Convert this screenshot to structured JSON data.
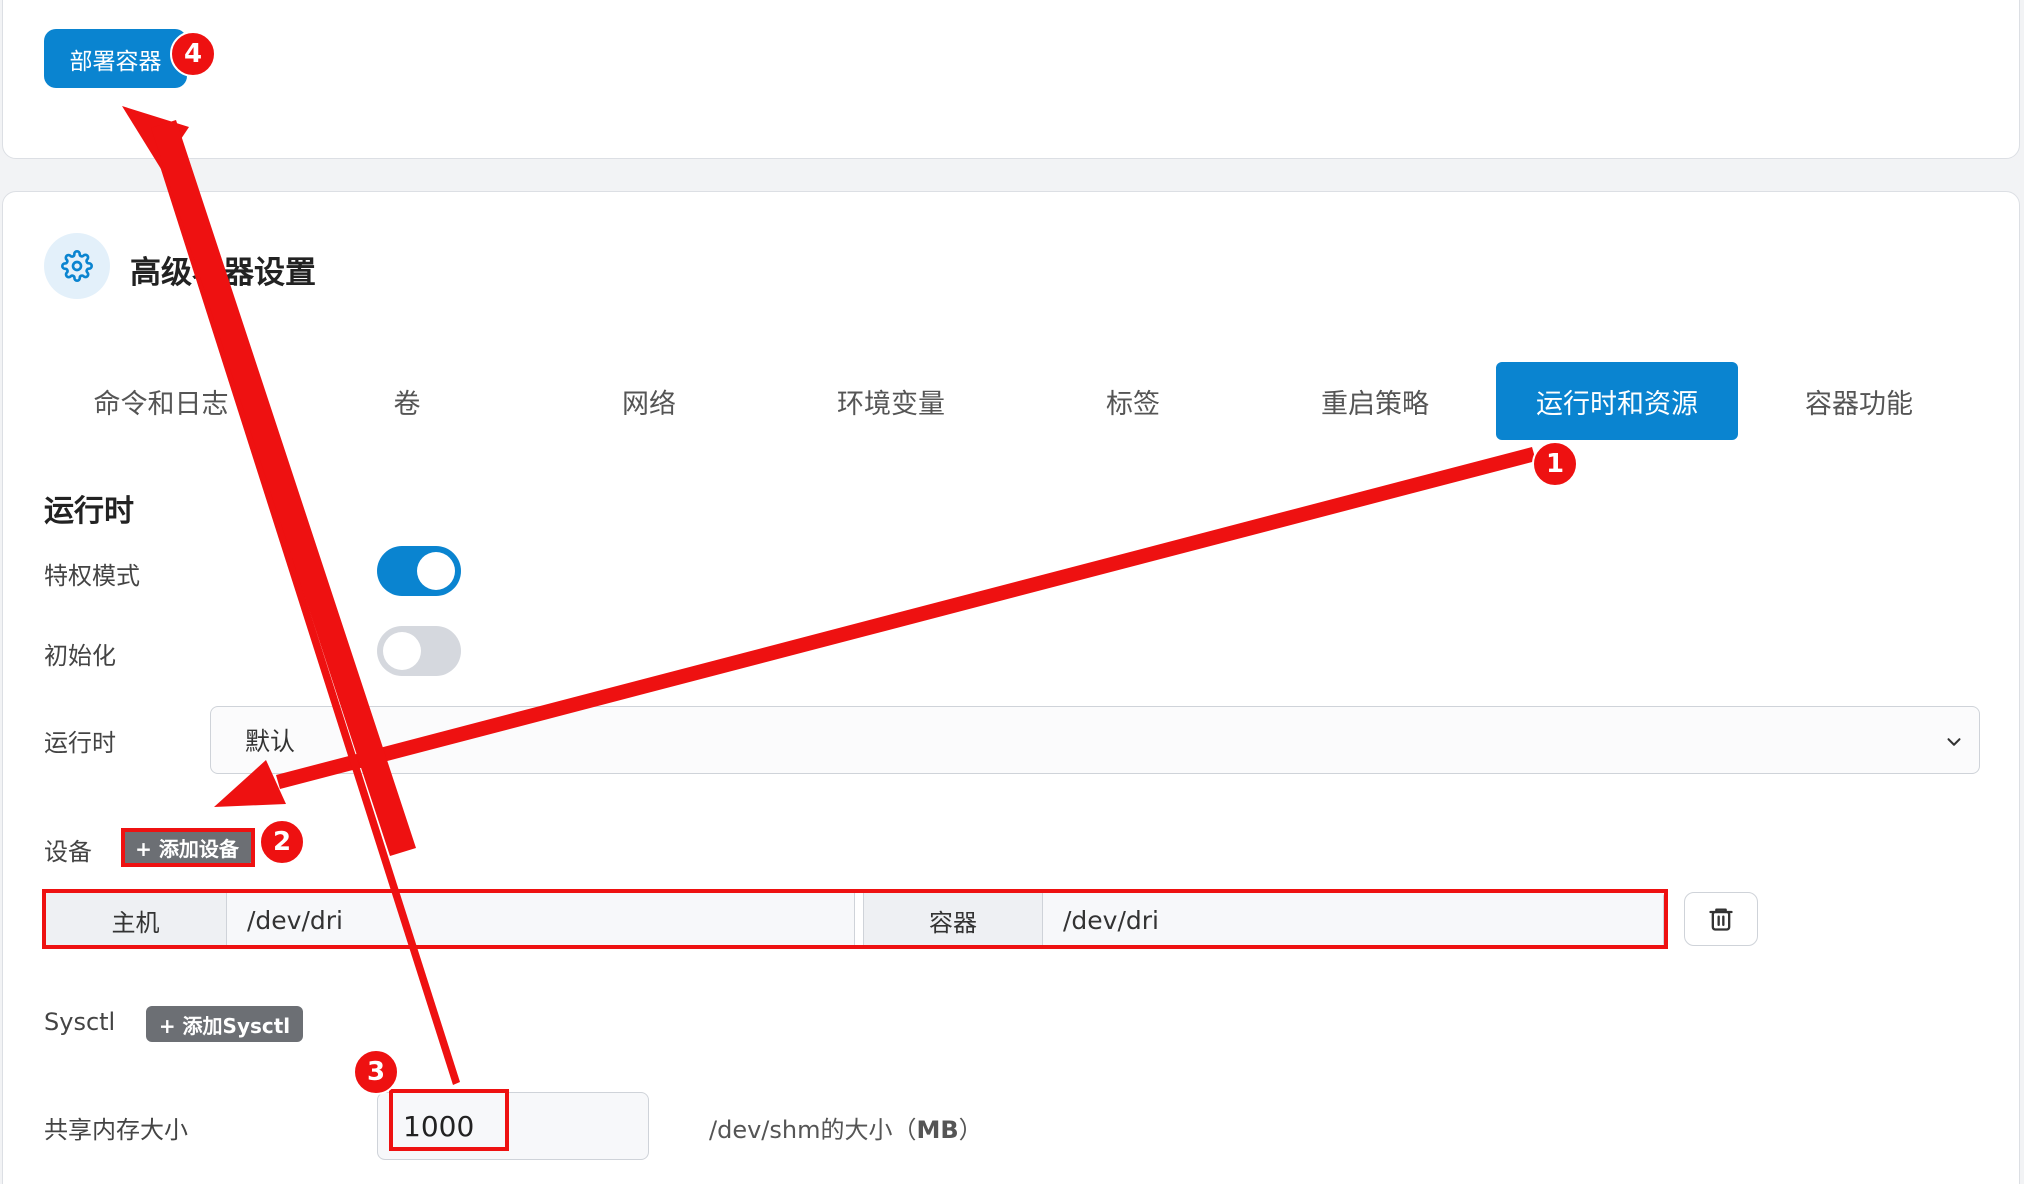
{
  "deploy_button": "部署容器",
  "advanced": {
    "title": "高级容器设置",
    "icon": "gear-icon"
  },
  "tabs": [
    {
      "label": "命令和日志",
      "active": false
    },
    {
      "label": "卷",
      "active": false
    },
    {
      "label": "网络",
      "active": false
    },
    {
      "label": "环境变量",
      "active": false
    },
    {
      "label": "标签",
      "active": false
    },
    {
      "label": "重启策略",
      "active": false
    },
    {
      "label": "运行时和资源",
      "active": true
    },
    {
      "label": "容器功能",
      "active": false
    }
  ],
  "runtime": {
    "section_title": "运行时",
    "privileged_label": "特权模式",
    "privileged_on": true,
    "init_label": "初始化",
    "init_on": false,
    "runtime_label": "运行时",
    "runtime_value": "默认",
    "devices_label": "设备",
    "add_device": "+ 添加设备",
    "device": {
      "host_label": "主机",
      "host_value": "/dev/dri",
      "container_label": "容器",
      "container_value": "/dev/dri"
    },
    "sysctl_label": "Sysctl",
    "add_sysctl": "+ 添加Sysctl",
    "shm_label": "共享内存大小",
    "shm_value": "1000",
    "shm_hint_prefix": "/dev/shm的大小（",
    "shm_hint_unit": "MB",
    "shm_hint_suffix": "）"
  },
  "annotations": {
    "steps": [
      "1",
      "2",
      "3",
      "4"
    ]
  },
  "colors": {
    "primary": "#0a84d0",
    "annotation": "#ee1111",
    "toggle_off": "#d5d8de"
  }
}
